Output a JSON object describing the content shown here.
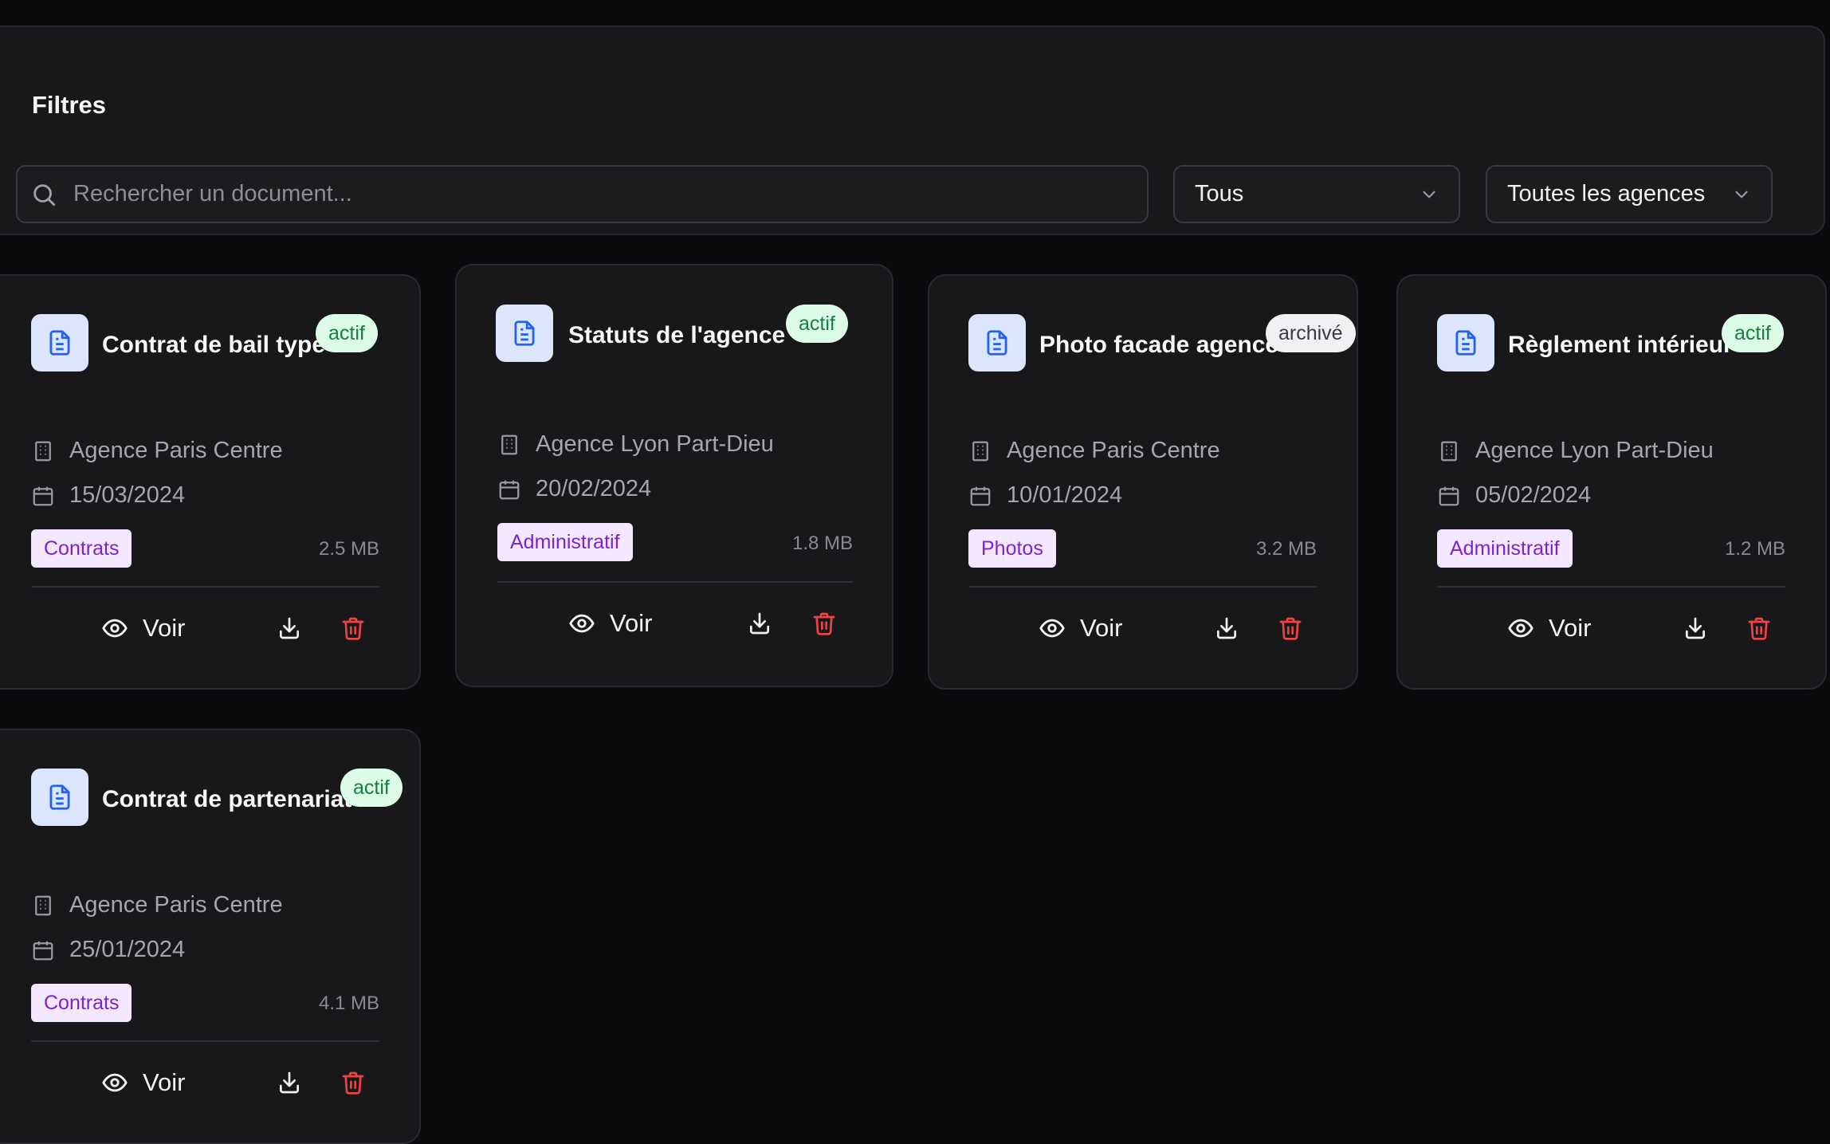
{
  "filters": {
    "title": "Filtres",
    "search_placeholder": "Rechercher un document...",
    "status_select": "Tous",
    "agency_select": "Toutes les agences"
  },
  "documents": [
    {
      "title": "Contrat de bail type",
      "status": "actif",
      "agency": "Agence Paris Centre",
      "date": "15/03/2024",
      "category": "Contrats",
      "size": "2.5 MB",
      "view_label": "Voir"
    },
    {
      "title": "Statuts de l'agence",
      "status": "actif",
      "agency": "Agence Lyon Part-Dieu",
      "date": "20/02/2024",
      "category": "Administratif",
      "size": "1.8 MB",
      "view_label": "Voir"
    },
    {
      "title": "Photo facade agence",
      "status": "archivé",
      "agency": "Agence Paris Centre",
      "date": "10/01/2024",
      "category": "Photos",
      "size": "3.2 MB",
      "view_label": "Voir"
    },
    {
      "title": "Règlement intérieur",
      "status": "actif",
      "agency": "Agence Lyon Part-Dieu",
      "date": "05/02/2024",
      "category": "Administratif",
      "size": "1.2 MB",
      "view_label": "Voir"
    },
    {
      "title": "Contrat de partenariat",
      "status": "actif",
      "agency": "Agence Paris Centre",
      "date": "25/01/2024",
      "category": "Contrats",
      "size": "4.1 MB",
      "view_label": "Voir"
    }
  ],
  "colors": {
    "background": "#0b0b0d",
    "card": "#18181b",
    "status_active_bg": "#dcfce7",
    "status_active_text": "#15803d",
    "status_archived_bg": "#f1f1f3",
    "category_bg": "#f3e8ff",
    "category_text": "#7e22ce",
    "doc_icon_bg": "#dbe6fd",
    "doc_icon": "#2563eb",
    "delete": "#ef4444"
  }
}
